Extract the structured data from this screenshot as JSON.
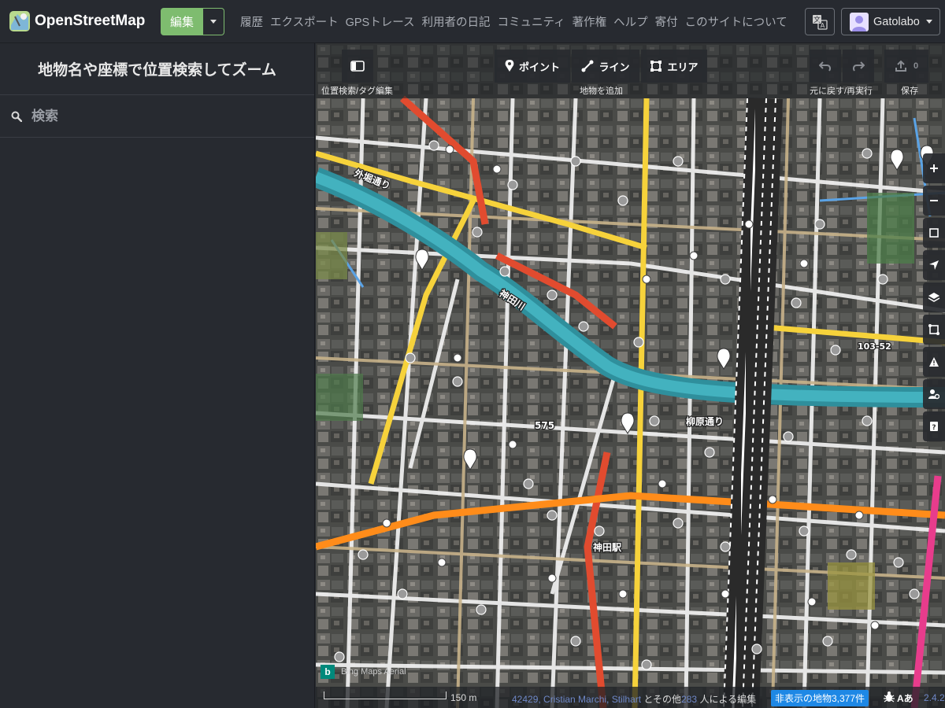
{
  "brand": {
    "name": "OpenStreetMap"
  },
  "nav": {
    "edit_label": "編集",
    "links": [
      "履歴",
      "エクスポート",
      "GPSトレース",
      "利用者の日記",
      "コミュニティ",
      "著作権",
      "ヘルプ",
      "寄付",
      "このサイトについて"
    ],
    "user_name": "Gatolabo"
  },
  "sidebar": {
    "title": "地物名や座標で位置検索してズーム",
    "search_placeholder": "検索"
  },
  "toolbar": {
    "inspector_label": "位置検索/タグ編集",
    "point_label": "ポイント",
    "line_label": "ライン",
    "area_label": "エリア",
    "add_feature_label": "地物を追加",
    "undo_redo_label": "元に戻す/再実行",
    "save_label": "保存",
    "save_count": "0"
  },
  "map": {
    "road_labels": [
      "外堀通り",
      "神田川",
      "柳原通り",
      "神田駅",
      "575",
      "103-52"
    ],
    "imagery_label": "Bing Maps Aerial",
    "scale_label": "150 m",
    "attribution": {
      "users": "42429, Cristian Marchi, Stilhart",
      "middle": "とその他",
      "count": "283",
      "suffix": "人による編集"
    },
    "hidden_features": "非表示の地物3,377件",
    "version": "2.4.2"
  },
  "colors": {
    "accent": "#7ebc6f",
    "topbar_bg": "#272a30",
    "hidden_badge": "#1e88e5",
    "river": "#3aa9b8",
    "primary_road": "#e85a35",
    "trunk_road": "#ff8c1a",
    "secondary_road": "#f6d23b"
  }
}
